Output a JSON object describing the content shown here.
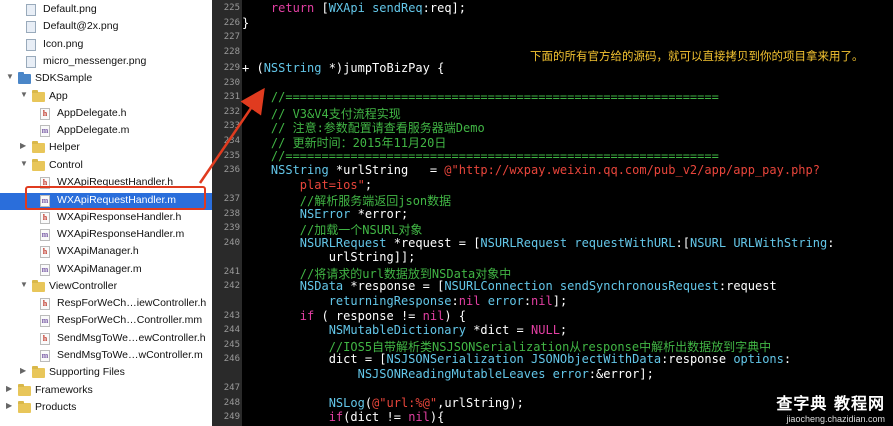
{
  "navigator": {
    "items": [
      {
        "label": "Default.png",
        "kind": "img",
        "indent": 1
      },
      {
        "label": "Default@2x.png",
        "kind": "img",
        "indent": 1
      },
      {
        "label": "Icon.png",
        "kind": "img",
        "indent": 1
      },
      {
        "label": "micro_messenger.png",
        "kind": "img",
        "indent": 1
      },
      {
        "label": "SDKSample",
        "kind": "folder",
        "indent": 0,
        "expanded": true
      },
      {
        "label": "App",
        "kind": "folder",
        "indent": 1,
        "expanded": true
      },
      {
        "label": "AppDelegate.h",
        "kind": "h",
        "indent": 2
      },
      {
        "label": "AppDelegate.m",
        "kind": "m",
        "indent": 2
      },
      {
        "label": "Helper",
        "kind": "folder",
        "indent": 1,
        "expanded": false
      },
      {
        "label": "Control",
        "kind": "folder",
        "indent": 1,
        "expanded": true
      },
      {
        "label": "WXApiRequestHandler.h",
        "kind": "h",
        "indent": 2
      },
      {
        "label": "WXApiRequestHandler.m",
        "kind": "m",
        "indent": 2,
        "selected": true
      },
      {
        "label": "WXApiResponseHandler.h",
        "kind": "h",
        "indent": 2
      },
      {
        "label": "WXApiResponseHandler.m",
        "kind": "m",
        "indent": 2
      },
      {
        "label": "WXApiManager.h",
        "kind": "h",
        "indent": 2
      },
      {
        "label": "WXApiManager.m",
        "kind": "m",
        "indent": 2
      },
      {
        "label": "ViewController",
        "kind": "folder",
        "indent": 1,
        "expanded": true
      },
      {
        "label": "RespForWeCh…iewController.h",
        "kind": "h",
        "indent": 2
      },
      {
        "label": "RespForWeCh…Controller.mm",
        "kind": "m",
        "indent": 2
      },
      {
        "label": "SendMsgToWe…ewController.h",
        "kind": "h",
        "indent": 2
      },
      {
        "label": "SendMsgToWe…wController.m",
        "kind": "m",
        "indent": 2
      },
      {
        "label": "Supporting Files",
        "kind": "folder",
        "indent": 1,
        "expanded": false
      },
      {
        "label": "Frameworks",
        "kind": "folder",
        "indent": 0,
        "expanded": false
      },
      {
        "label": "Products",
        "kind": "folder",
        "indent": 0,
        "expanded": false
      }
    ]
  },
  "editor": {
    "annotation": "下面的所有官方给的源码，就可以直接拷贝到你的项目拿来用了。",
    "highlight_line": "229",
    "lines": [
      {
        "n": "225",
        "segs": [
          [
            "    ",
            "p"
          ],
          [
            "return",
            "kw"
          ],
          [
            " [",
            "p"
          ],
          [
            "WXApi",
            "ty"
          ],
          [
            " ",
            "p"
          ],
          [
            "sendReq",
            "ty"
          ],
          [
            ":req];",
            "p"
          ]
        ]
      },
      {
        "n": "226",
        "segs": [
          [
            "}",
            "p"
          ]
        ]
      },
      {
        "n": "227",
        "segs": []
      },
      {
        "n": "228",
        "segs": []
      },
      {
        "n": "229",
        "segs": [
          [
            "+ (",
            "p"
          ],
          [
            "NSString",
            "ty"
          ],
          [
            " *)jumpToBizPay {",
            "p"
          ]
        ]
      },
      {
        "n": "230",
        "segs": []
      },
      {
        "n": "231",
        "segs": [
          [
            "    //============================================================",
            "cm"
          ]
        ]
      },
      {
        "n": "232",
        "segs": [
          [
            "    // V3&V4支付流程实现",
            "cm"
          ]
        ]
      },
      {
        "n": "233",
        "segs": [
          [
            "    // 注意:参数配置请查看服务器端Demo",
            "cm"
          ]
        ]
      },
      {
        "n": "234",
        "segs": [
          [
            "    // 更新时间：2015年11月20日",
            "cm"
          ]
        ]
      },
      {
        "n": "235",
        "segs": [
          [
            "    //============================================================",
            "cm"
          ]
        ]
      },
      {
        "n": "236",
        "segs": [
          [
            "    ",
            "p"
          ],
          [
            "NSString",
            "ty"
          ],
          [
            " *urlString   = ",
            "p"
          ],
          [
            "@\"http://wxpay.weixin.qq.com/pub_v2/app/app_pay.php?",
            "st"
          ]
        ]
      },
      {
        "n": "",
        "segs": [
          [
            "        plat=ios\"",
            "st"
          ],
          [
            ";",
            "p"
          ]
        ]
      },
      {
        "n": "237",
        "segs": [
          [
            "        //解析服务端返回json数据",
            "cm"
          ]
        ]
      },
      {
        "n": "238",
        "segs": [
          [
            "        ",
            "p"
          ],
          [
            "NSError",
            "ty"
          ],
          [
            " *error;",
            "p"
          ]
        ]
      },
      {
        "n": "239",
        "segs": [
          [
            "        //加载一个NSURL对象",
            "cm"
          ]
        ]
      },
      {
        "n": "240",
        "segs": [
          [
            "        ",
            "p"
          ],
          [
            "NSURLRequest",
            "ty"
          ],
          [
            " *request = [",
            "p"
          ],
          [
            "NSURLRequest",
            "ty"
          ],
          [
            " ",
            "p"
          ],
          [
            "requestWithURL",
            "ty"
          ],
          [
            ":[",
            "p"
          ],
          [
            "NSURL",
            "ty"
          ],
          [
            " ",
            "p"
          ],
          [
            "URLWithString",
            "ty"
          ],
          [
            ":",
            "p"
          ]
        ]
      },
      {
        "n": "",
        "segs": [
          [
            "            urlString]];",
            "p"
          ]
        ]
      },
      {
        "n": "241",
        "segs": [
          [
            "        //将请求的url数据放到NSData对象中",
            "cm"
          ]
        ]
      },
      {
        "n": "242",
        "segs": [
          [
            "        ",
            "p"
          ],
          [
            "NSData",
            "ty"
          ],
          [
            " *response = [",
            "p"
          ],
          [
            "NSURLConnection",
            "ty"
          ],
          [
            " ",
            "p"
          ],
          [
            "sendSynchronousRequest",
            "ty"
          ],
          [
            ":request",
            "p"
          ]
        ]
      },
      {
        "n": "",
        "segs": [
          [
            "            ",
            "p"
          ],
          [
            "returningResponse",
            "ty"
          ],
          [
            ":",
            "p"
          ],
          [
            "nil",
            "kw"
          ],
          [
            " ",
            "p"
          ],
          [
            "error",
            "ty"
          ],
          [
            ":",
            "p"
          ],
          [
            "nil",
            "kw"
          ],
          [
            "];",
            "p"
          ]
        ]
      },
      {
        "n": "243",
        "segs": [
          [
            "        ",
            "p"
          ],
          [
            "if",
            "kw"
          ],
          [
            " ( response != ",
            "p"
          ],
          [
            "nil",
            "kw"
          ],
          [
            ") {",
            "p"
          ]
        ]
      },
      {
        "n": "244",
        "segs": [
          [
            "            ",
            "p"
          ],
          [
            "NSMutableDictionary",
            "ty"
          ],
          [
            " *dict = ",
            "p"
          ],
          [
            "NULL",
            "kw"
          ],
          [
            ";",
            "p"
          ]
        ]
      },
      {
        "n": "245",
        "segs": [
          [
            "            //IOS5自带解析类NSJSONSerialization从response中解析出数据放到字典中",
            "cm"
          ]
        ]
      },
      {
        "n": "246",
        "segs": [
          [
            "            dict = [",
            "p"
          ],
          [
            "NSJSONSerialization",
            "ty"
          ],
          [
            " ",
            "p"
          ],
          [
            "JSONObjectWithData",
            "ty"
          ],
          [
            ":response ",
            "p"
          ],
          [
            "options",
            "ty"
          ],
          [
            ":",
            "p"
          ]
        ]
      },
      {
        "n": "",
        "segs": [
          [
            "                ",
            "p"
          ],
          [
            "NSJSONReadingMutableLeaves",
            "ty"
          ],
          [
            " ",
            "p"
          ],
          [
            "error",
            "ty"
          ],
          [
            ":&error];",
            "p"
          ]
        ]
      },
      {
        "n": "247",
        "segs": []
      },
      {
        "n": "248",
        "segs": [
          [
            "            ",
            "p"
          ],
          [
            "NSLog",
            "ty"
          ],
          [
            "(",
            "p"
          ],
          [
            "@\"url:%@\"",
            "st"
          ],
          [
            ",urlString);",
            "p"
          ]
        ]
      },
      {
        "n": "249",
        "segs": [
          [
            "            ",
            "p"
          ],
          [
            "if",
            "kw"
          ],
          [
            "(dict != ",
            "p"
          ],
          [
            "nil",
            "kw"
          ],
          [
            "){",
            "p"
          ]
        ]
      }
    ]
  },
  "watermark": {
    "title": "查字典 教程网",
    "url": "jiaocheng.chazidian.com"
  },
  "colors": {
    "selection": "#2a6edb",
    "callout": "#e03b1f",
    "annotation": "#f5c431",
    "comment": "#41b645",
    "keyword": "#e23fa2",
    "type": "#63c6e8",
    "string": "#e8453b"
  }
}
